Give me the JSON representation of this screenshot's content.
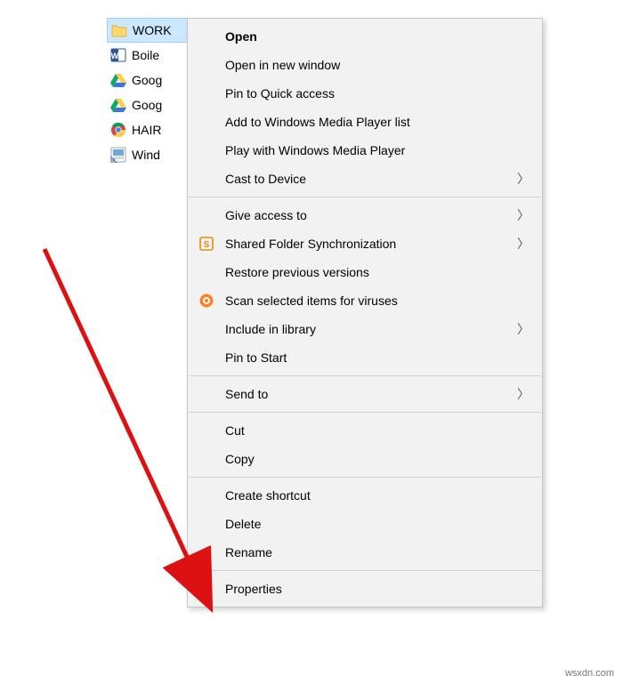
{
  "files": [
    {
      "name": "WORK",
      "icon": "folder",
      "selected": true
    },
    {
      "name": "Boile",
      "icon": "word",
      "selected": false
    },
    {
      "name": "Goog",
      "icon": "drive",
      "selected": false
    },
    {
      "name": "Goog",
      "icon": "drive",
      "selected": false
    },
    {
      "name": "HAIR",
      "icon": "chrome",
      "selected": false
    },
    {
      "name": "Wind",
      "icon": "shortcut",
      "selected": false
    }
  ],
  "menu": {
    "open": "Open",
    "open_new": "Open in new window",
    "pin_quick": "Pin to Quick access",
    "wmp_add": "Add to Windows Media Player list",
    "wmp_play": "Play with Windows Media Player",
    "cast": "Cast to Device",
    "give_access": "Give access to",
    "shared_sync": "Shared Folder Synchronization",
    "restore": "Restore previous versions",
    "scan": "Scan selected items for viruses",
    "include_lib": "Include in library",
    "pin_start": "Pin to Start",
    "send_to": "Send to",
    "cut": "Cut",
    "copy": "Copy",
    "create_sc": "Create shortcut",
    "delete": "Delete",
    "rename": "Rename",
    "properties": "Properties"
  },
  "watermark": "wsxdn.com"
}
